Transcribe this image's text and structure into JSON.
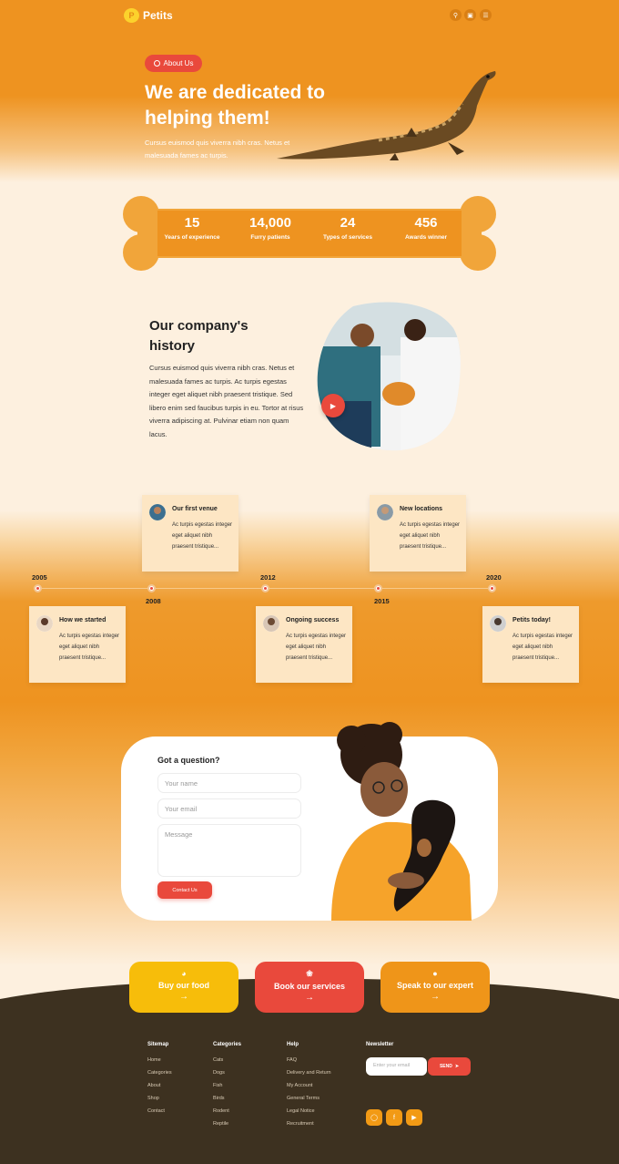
{
  "header": {
    "logo_text": "Petits",
    "logo_mark": "P"
  },
  "hero": {
    "pill_label": "About Us",
    "title": "We are dedicated to helping them!",
    "text": "Cursus euismod quis viverra nibh cras. Netus et malesuada fames ac turpis."
  },
  "stats": [
    {
      "num": "15",
      "label": "Years of experience"
    },
    {
      "num": "14,000",
      "label": "Furry patients"
    },
    {
      "num": "24",
      "label": "Types of services"
    },
    {
      "num": "456",
      "label": "Awards winner"
    }
  ],
  "history": {
    "title": "Our company's history",
    "text": "Cursus euismod quis viverra nibh cras. Netus et malesuada fames ac turpis. Ac turpis egestas integer eget aliquet nibh praesent tristique. Sed libero enim sed faucibus turpis in eu. Tortor at risus viverra adipiscing at. Pulvinar etiam non quam lacus."
  },
  "timeline": {
    "years": [
      "2005",
      "2008",
      "2012",
      "2015",
      "2020"
    ],
    "cards": [
      {
        "title": "Our first venue",
        "text": "Ac turpis egestas integer eget aliquet nibh praesent tristique..."
      },
      {
        "title": "New locations",
        "text": "Ac turpis egestas integer eget aliquet nibh praesent tristique..."
      },
      {
        "title": "How we started",
        "text": "Ac turpis egestas integer eget aliquet nibh praesent tristique..."
      },
      {
        "title": "Ongoing success",
        "text": "Ac turpis egestas integer eget aliquet nibh praesent tristique..."
      },
      {
        "title": "Petits today!",
        "text": "Ac turpis egestas integer eget aliquet nibh praesent tristique..."
      }
    ]
  },
  "contact": {
    "title": "Got a question?",
    "name_placeholder": "Your name",
    "email_placeholder": "Your email",
    "message_placeholder": "Message",
    "submit_label": "Contact Us"
  },
  "cta": [
    {
      "label": "Buy our food",
      "icon": "bowl-icon",
      "color": "#f7bd0a"
    },
    {
      "label": "Book our services",
      "icon": "lotus-icon",
      "color": "#e9493c"
    },
    {
      "label": "Speak to our expert",
      "icon": "person-icon",
      "color": "#ef9519"
    }
  ],
  "footer": {
    "sitemap": {
      "title": "Sitemap",
      "links": [
        "Home",
        "Categories",
        "About",
        "Shop",
        "Contact"
      ]
    },
    "categories": {
      "title": "Categories",
      "links": [
        "Cats",
        "Dogs",
        "Fish",
        "Birds",
        "Rodent",
        "Reptile"
      ]
    },
    "help": {
      "title": "Help",
      "links": [
        "FAQ",
        "Delivery and Return",
        "My Account",
        "General Terms",
        "Legal Notice",
        "Recruitment"
      ]
    },
    "newsletter": {
      "title": "Newsletter",
      "placeholder": "Enter your email",
      "button": "SEND"
    }
  },
  "colors": {
    "orange": "#ee9320",
    "accent_red": "#e9493c",
    "cream": "#fdf0df",
    "footer_brown": "#3d3120"
  }
}
